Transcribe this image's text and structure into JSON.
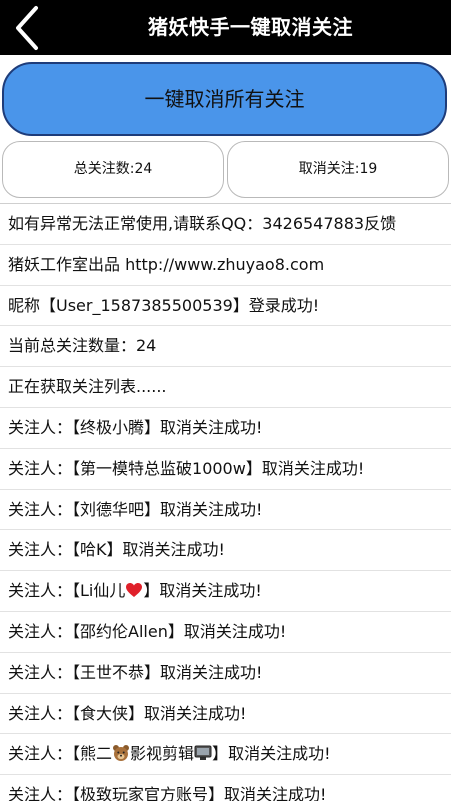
{
  "topbar": {
    "title": "猪妖快手一键取消关注"
  },
  "main_button": {
    "label": "一键取消所有关注"
  },
  "stats": {
    "total_label": "总关注数:24",
    "cancelled_label": "取消关注:19"
  },
  "log": {
    "lines": [
      {
        "text": "如有异常无法正常使用,请联系QQ：3426547883反馈"
      },
      {
        "text": "猪妖工作室出品 http://www.zhuyao8.com"
      },
      {
        "text": "昵称【User_1587385500539】登录成功!"
      },
      {
        "text": "当前总关注数量：24"
      },
      {
        "text": "正在获取关注列表......"
      }
    ],
    "follow_prefix": "关注人：",
    "success_suffix": "取消关注成功!",
    "follows": [
      {
        "name": "【终极小腾】"
      },
      {
        "name": "【第一模特总监破1000w】"
      },
      {
        "name": "【刘德华吧】"
      },
      {
        "name": "【哈K】"
      },
      {
        "name_pre": "【Li仙儿",
        "icon": "heart-icon",
        "name_post": "】"
      },
      {
        "name": "【邵约伦Allen】"
      },
      {
        "name": "【王世不恭】"
      },
      {
        "name": "【食大侠】"
      },
      {
        "name_pre": "【熊二",
        "icon": "bear-icon",
        "name_mid": "影视剪辑",
        "icon2": "monitor-icon",
        "name_post": "】"
      },
      {
        "name": "【极致玩家官方账号】"
      }
    ]
  },
  "colors": {
    "topbar_bg": "#000000",
    "main_button_bg": "#4a95ea",
    "main_button_border": "#1e3c7a",
    "heart": "#e0202a"
  }
}
